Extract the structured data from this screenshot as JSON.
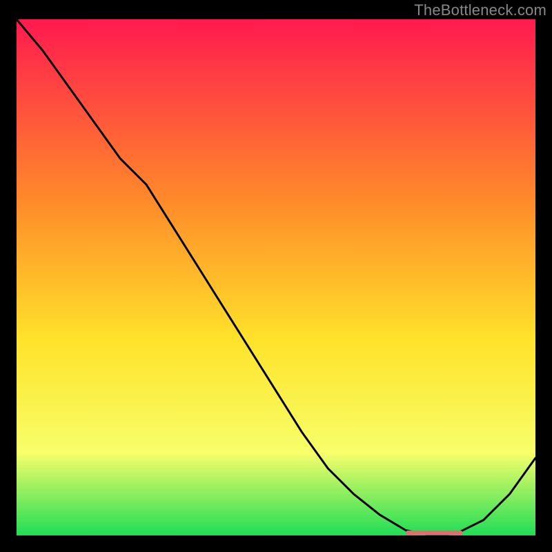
{
  "watermark": "TheBottleneck.com",
  "colors": {
    "frame_bg": "#000000",
    "line": "#000000",
    "marker": "#d6736f",
    "grad_top": "#ff1a4f",
    "grad_mid1": "#ff8a2a",
    "grad_mid2": "#ffe22a",
    "grad_mid3": "#f7ff6a",
    "grad_bottom": "#1fdd55"
  },
  "chart_data": {
    "type": "line",
    "title": "",
    "xlabel": "",
    "ylabel": "",
    "xlim": [
      0,
      100
    ],
    "ylim": [
      0,
      100
    ],
    "x": [
      0,
      5,
      10,
      15,
      20,
      25,
      30,
      35,
      40,
      45,
      50,
      55,
      60,
      65,
      70,
      75,
      80,
      82,
      85,
      90,
      95,
      100
    ],
    "values": [
      100,
      94,
      87,
      80,
      73,
      68,
      60,
      52,
      44,
      36,
      28,
      20,
      13,
      8,
      4,
      1,
      0,
      0,
      0.5,
      3,
      8,
      15
    ],
    "marker_segment": {
      "x_start": 75,
      "x_end": 86,
      "y": 0.5
    },
    "annotations": []
  }
}
